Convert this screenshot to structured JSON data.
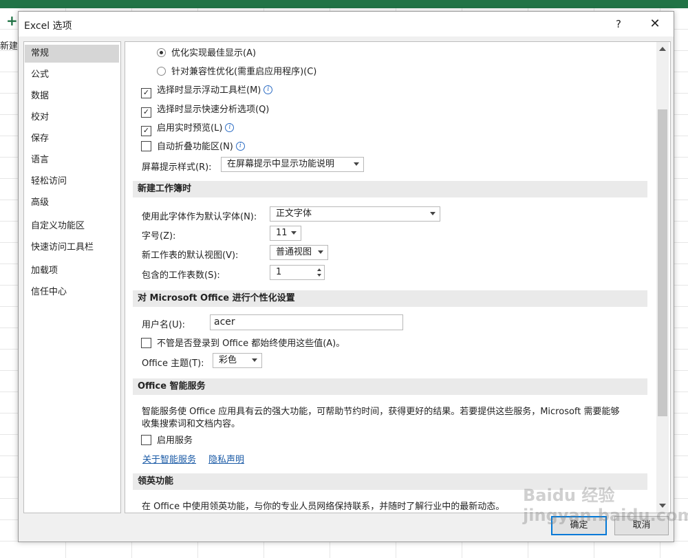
{
  "background": {
    "new_label": "新建"
  },
  "dialog": {
    "title": "Excel 选项",
    "help": "?",
    "close": "✕",
    "nav": [
      "常规",
      "公式",
      "数据",
      "校对",
      "保存",
      "语言",
      "轻松访问",
      "高级",
      "自定义功能区",
      "快速访问工具栏",
      "加载项",
      "信任中心"
    ],
    "selected_nav": "常规",
    "ui": {
      "radio_best": "优化实现最佳显示(A)",
      "radio_compat": "针对兼容性优化(需重启应用程序)(C)",
      "mini_toolbar": "选择时显示浮动工具栏(M)",
      "quick_analysis": "选择时显示快速分析选项(Q)",
      "live_preview": "启用实时预览(L)",
      "collapse_ribbon": "自动折叠功能区(N)",
      "screentip_label": "屏幕提示样式(R):",
      "screentip_value": "在屏幕提示中显示功能说明"
    },
    "new_workbook": {
      "header": "新建工作簿时",
      "font_label": "使用此字体作为默认字体(N):",
      "font_value": "正文字体",
      "size_label": "字号(Z):",
      "size_value": "11",
      "view_label": "新工作表的默认视图(V):",
      "view_value": "普通视图",
      "sheets_label": "包含的工作表数(S):",
      "sheets_value": "1"
    },
    "personalize": {
      "header": "对 Microsoft Office 进行个性化设置",
      "user_label": "用户名(U):",
      "user_value": "acer",
      "always_use": "不管是否登录到 Office 都始终使用这些值(A)。",
      "theme_label": "Office 主题(T):",
      "theme_value": "彩色"
    },
    "intelligent": {
      "header": "Office 智能服务",
      "desc1": "智能服务使 Office 应用具有云的强大功能，可帮助节约时间，获得更好的结果。若要提供这些服务，Microsoft 需要能够",
      "desc2": "收集搜索词和文档内容。",
      "enable": "启用服务",
      "about_link": "关于智能服务",
      "privacy_link": "隐私声明"
    },
    "linkedin": {
      "header": "领英功能",
      "desc": "在 Office 中使用领英功能，与你的专业人员网络保持联系，并随时了解行业中的最新动态。"
    },
    "ok": "确定",
    "cancel": "取消"
  },
  "watermark": "Baidu 经验 jingyan.baidu.com"
}
